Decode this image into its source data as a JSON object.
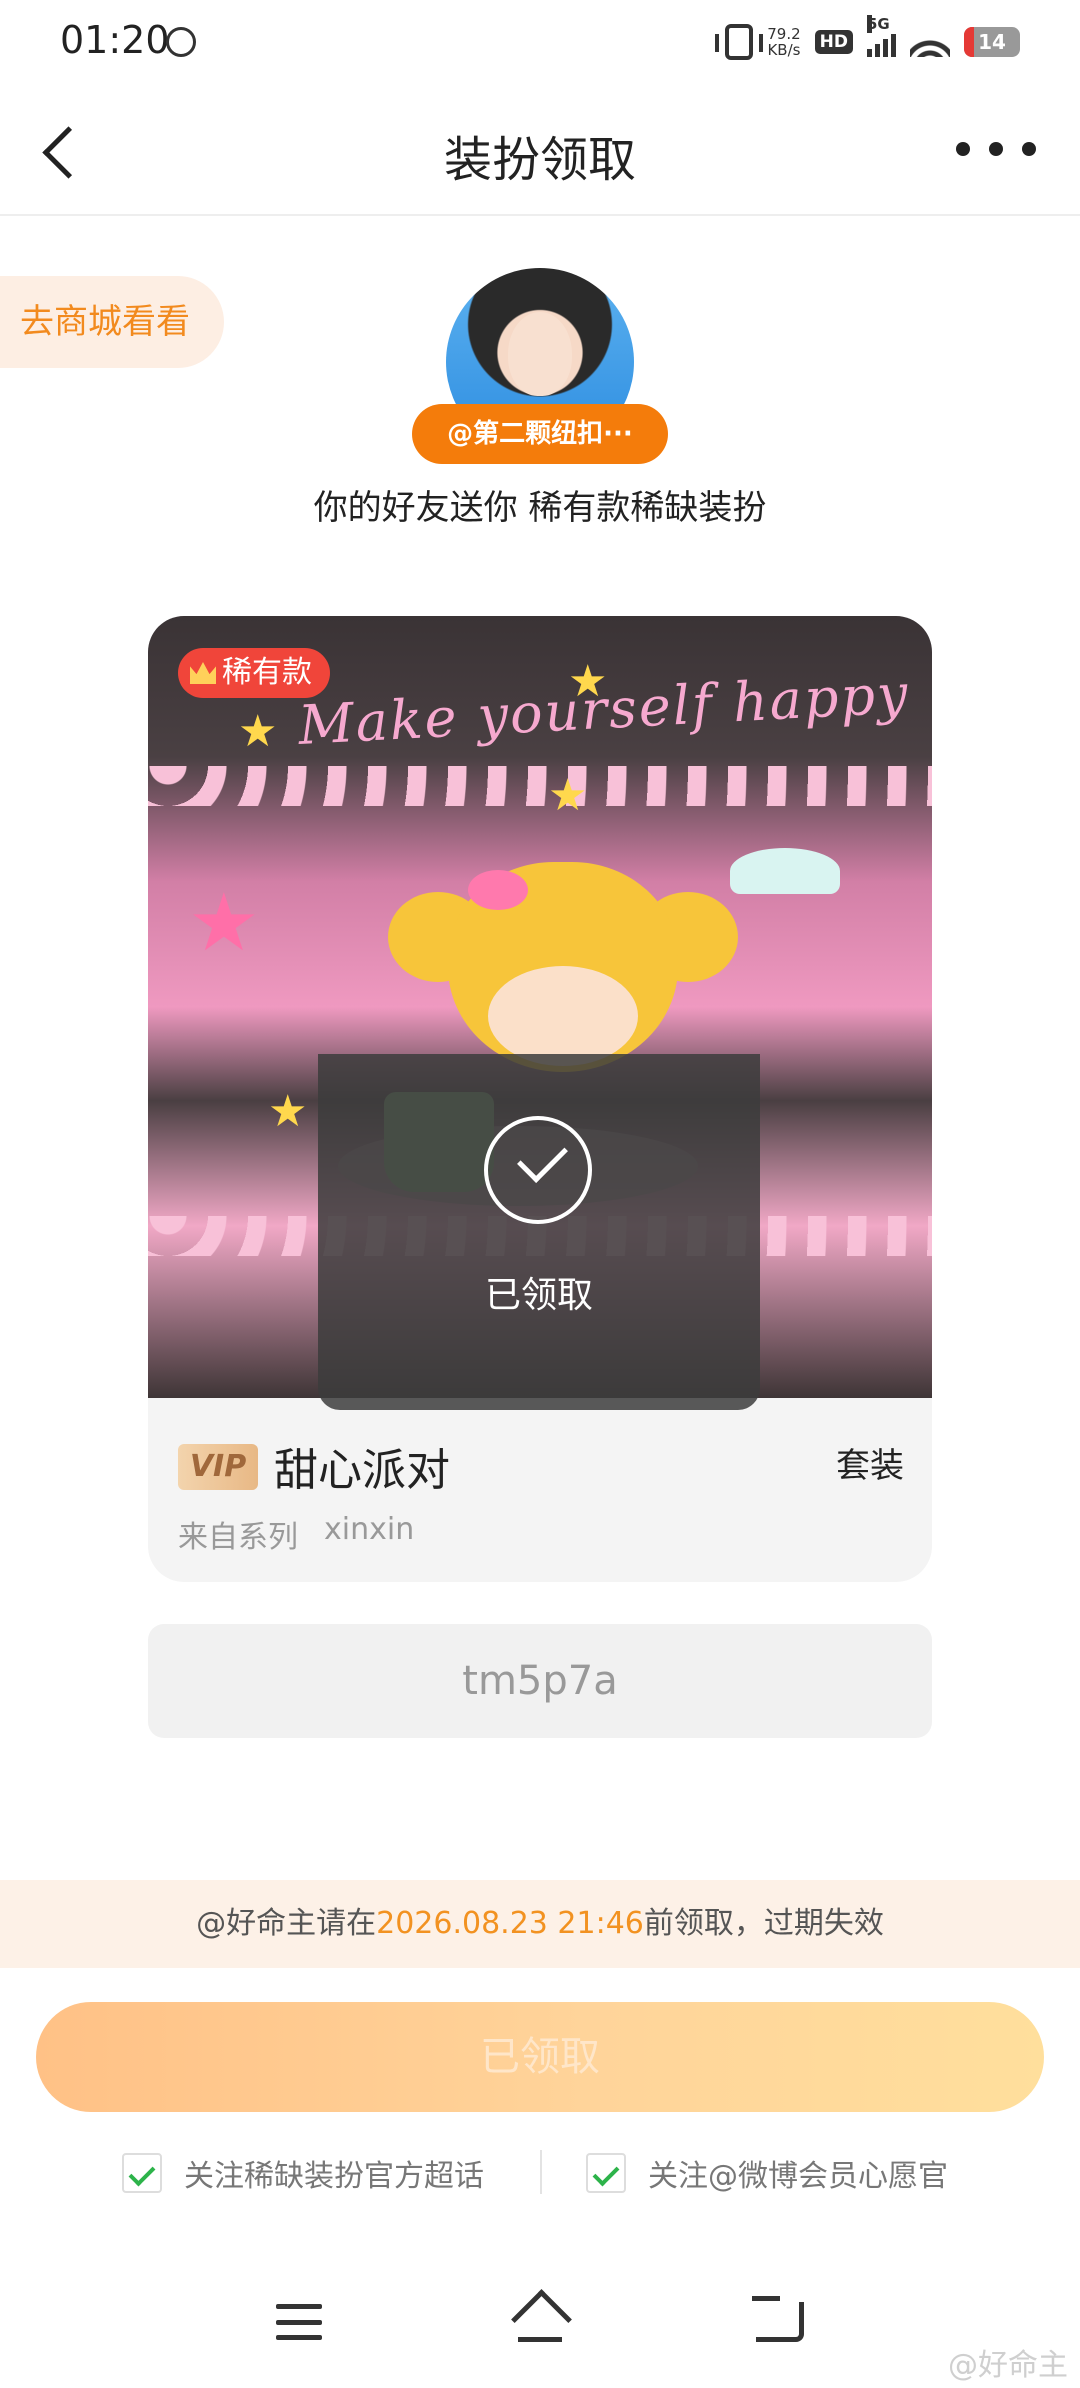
{
  "status_bar": {
    "time": "01:20",
    "net_speed_value": "79.2",
    "net_speed_unit": "KB/s",
    "hd_label": "HD",
    "signal_label": "5G",
    "battery_level": "14"
  },
  "header": {
    "title": "装扮领取"
  },
  "mall_button": {
    "label": "去商城看看"
  },
  "sender": {
    "name": "@第二颗纽扣···",
    "gift_message": "你的好友送你 稀有款稀缺装扮"
  },
  "item": {
    "rarity_badge": "稀有款",
    "scene_text": "Make yourself happy",
    "claimed_label": "已领取",
    "vip_label": "VIP",
    "name": "甜心派对",
    "type_tag": "套装",
    "series_label": "来自系列",
    "series_name": "xinxin"
  },
  "redeem_code": {
    "value": "tm5p7a"
  },
  "deadline": {
    "prefix": "@好命主请在",
    "datetime": "2026.08.23 21:46",
    "suffix": "前领取，过期失效"
  },
  "claim_button": {
    "label": "已领取"
  },
  "follow_options": [
    {
      "label": "关注稀缺装扮官方超话",
      "checked": true
    },
    {
      "label": "关注@微博会员心愿官",
      "checked": true
    }
  ],
  "watermark": "@好命主",
  "colors": {
    "accent_orange": "#f47c0b",
    "rare_red": "#f0453a",
    "check_green": "#2db34a"
  }
}
